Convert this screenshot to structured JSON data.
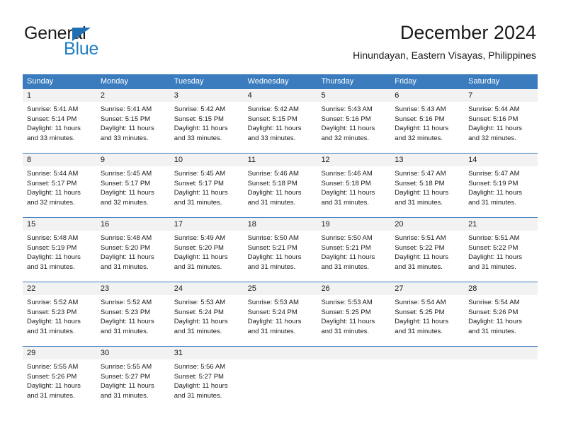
{
  "logo": {
    "word_top": "General",
    "word_bottom": "Blue",
    "triangle_color": "#1f6fb5",
    "blue_color": "#1f7ec4"
  },
  "header": {
    "title": "December 2024",
    "subtitle": "Hinundayan, Eastern Visayas, Philippines"
  },
  "theme": {
    "header_bg": "#3a7cbe",
    "header_text": "#ffffff",
    "daynum_bg": "#f2f2f2",
    "row_border": "#3a7cbe"
  },
  "weekday_headers": [
    "Sunday",
    "Monday",
    "Tuesday",
    "Wednesday",
    "Thursday",
    "Friday",
    "Saturday"
  ],
  "weeks": [
    [
      {
        "day": "1",
        "sunrise": "Sunrise: 5:41 AM",
        "sunset": "Sunset: 5:14 PM",
        "daylight": "Daylight: 11 hours and 33 minutes."
      },
      {
        "day": "2",
        "sunrise": "Sunrise: 5:41 AM",
        "sunset": "Sunset: 5:15 PM",
        "daylight": "Daylight: 11 hours and 33 minutes."
      },
      {
        "day": "3",
        "sunrise": "Sunrise: 5:42 AM",
        "sunset": "Sunset: 5:15 PM",
        "daylight": "Daylight: 11 hours and 33 minutes."
      },
      {
        "day": "4",
        "sunrise": "Sunrise: 5:42 AM",
        "sunset": "Sunset: 5:15 PM",
        "daylight": "Daylight: 11 hours and 33 minutes."
      },
      {
        "day": "5",
        "sunrise": "Sunrise: 5:43 AM",
        "sunset": "Sunset: 5:16 PM",
        "daylight": "Daylight: 11 hours and 32 minutes."
      },
      {
        "day": "6",
        "sunrise": "Sunrise: 5:43 AM",
        "sunset": "Sunset: 5:16 PM",
        "daylight": "Daylight: 11 hours and 32 minutes."
      },
      {
        "day": "7",
        "sunrise": "Sunrise: 5:44 AM",
        "sunset": "Sunset: 5:16 PM",
        "daylight": "Daylight: 11 hours and 32 minutes."
      }
    ],
    [
      {
        "day": "8",
        "sunrise": "Sunrise: 5:44 AM",
        "sunset": "Sunset: 5:17 PM",
        "daylight": "Daylight: 11 hours and 32 minutes."
      },
      {
        "day": "9",
        "sunrise": "Sunrise: 5:45 AM",
        "sunset": "Sunset: 5:17 PM",
        "daylight": "Daylight: 11 hours and 32 minutes."
      },
      {
        "day": "10",
        "sunrise": "Sunrise: 5:45 AM",
        "sunset": "Sunset: 5:17 PM",
        "daylight": "Daylight: 11 hours and 31 minutes."
      },
      {
        "day": "11",
        "sunrise": "Sunrise: 5:46 AM",
        "sunset": "Sunset: 5:18 PM",
        "daylight": "Daylight: 11 hours and 31 minutes."
      },
      {
        "day": "12",
        "sunrise": "Sunrise: 5:46 AM",
        "sunset": "Sunset: 5:18 PM",
        "daylight": "Daylight: 11 hours and 31 minutes."
      },
      {
        "day": "13",
        "sunrise": "Sunrise: 5:47 AM",
        "sunset": "Sunset: 5:18 PM",
        "daylight": "Daylight: 11 hours and 31 minutes."
      },
      {
        "day": "14",
        "sunrise": "Sunrise: 5:47 AM",
        "sunset": "Sunset: 5:19 PM",
        "daylight": "Daylight: 11 hours and 31 minutes."
      }
    ],
    [
      {
        "day": "15",
        "sunrise": "Sunrise: 5:48 AM",
        "sunset": "Sunset: 5:19 PM",
        "daylight": "Daylight: 11 hours and 31 minutes."
      },
      {
        "day": "16",
        "sunrise": "Sunrise: 5:48 AM",
        "sunset": "Sunset: 5:20 PM",
        "daylight": "Daylight: 11 hours and 31 minutes."
      },
      {
        "day": "17",
        "sunrise": "Sunrise: 5:49 AM",
        "sunset": "Sunset: 5:20 PM",
        "daylight": "Daylight: 11 hours and 31 minutes."
      },
      {
        "day": "18",
        "sunrise": "Sunrise: 5:50 AM",
        "sunset": "Sunset: 5:21 PM",
        "daylight": "Daylight: 11 hours and 31 minutes."
      },
      {
        "day": "19",
        "sunrise": "Sunrise: 5:50 AM",
        "sunset": "Sunset: 5:21 PM",
        "daylight": "Daylight: 11 hours and 31 minutes."
      },
      {
        "day": "20",
        "sunrise": "Sunrise: 5:51 AM",
        "sunset": "Sunset: 5:22 PM",
        "daylight": "Daylight: 11 hours and 31 minutes."
      },
      {
        "day": "21",
        "sunrise": "Sunrise: 5:51 AM",
        "sunset": "Sunset: 5:22 PM",
        "daylight": "Daylight: 11 hours and 31 minutes."
      }
    ],
    [
      {
        "day": "22",
        "sunrise": "Sunrise: 5:52 AM",
        "sunset": "Sunset: 5:23 PM",
        "daylight": "Daylight: 11 hours and 31 minutes."
      },
      {
        "day": "23",
        "sunrise": "Sunrise: 5:52 AM",
        "sunset": "Sunset: 5:23 PM",
        "daylight": "Daylight: 11 hours and 31 minutes."
      },
      {
        "day": "24",
        "sunrise": "Sunrise: 5:53 AM",
        "sunset": "Sunset: 5:24 PM",
        "daylight": "Daylight: 11 hours and 31 minutes."
      },
      {
        "day": "25",
        "sunrise": "Sunrise: 5:53 AM",
        "sunset": "Sunset: 5:24 PM",
        "daylight": "Daylight: 11 hours and 31 minutes."
      },
      {
        "day": "26",
        "sunrise": "Sunrise: 5:53 AM",
        "sunset": "Sunset: 5:25 PM",
        "daylight": "Daylight: 11 hours and 31 minutes."
      },
      {
        "day": "27",
        "sunrise": "Sunrise: 5:54 AM",
        "sunset": "Sunset: 5:25 PM",
        "daylight": "Daylight: 11 hours and 31 minutes."
      },
      {
        "day": "28",
        "sunrise": "Sunrise: 5:54 AM",
        "sunset": "Sunset: 5:26 PM",
        "daylight": "Daylight: 11 hours and 31 minutes."
      }
    ],
    [
      {
        "day": "29",
        "sunrise": "Sunrise: 5:55 AM",
        "sunset": "Sunset: 5:26 PM",
        "daylight": "Daylight: 11 hours and 31 minutes."
      },
      {
        "day": "30",
        "sunrise": "Sunrise: 5:55 AM",
        "sunset": "Sunset: 5:27 PM",
        "daylight": "Daylight: 11 hours and 31 minutes."
      },
      {
        "day": "31",
        "sunrise": "Sunrise: 5:56 AM",
        "sunset": "Sunset: 5:27 PM",
        "daylight": "Daylight: 11 hours and 31 minutes."
      },
      {
        "day": "",
        "sunrise": "",
        "sunset": "",
        "daylight": ""
      },
      {
        "day": "",
        "sunrise": "",
        "sunset": "",
        "daylight": ""
      },
      {
        "day": "",
        "sunrise": "",
        "sunset": "",
        "daylight": ""
      },
      {
        "day": "",
        "sunrise": "",
        "sunset": "",
        "daylight": ""
      }
    ]
  ]
}
